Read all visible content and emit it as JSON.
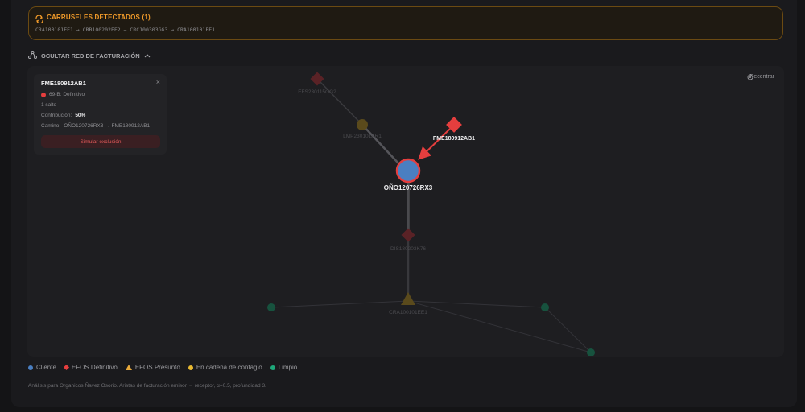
{
  "carousel": {
    "title": "CARRUSELES DETECTADOS (1)",
    "chain": "CRA100101EE1  →  CRB100202FF2  →  CRC100303GG3  →  CRA100101EE1"
  },
  "toggle": {
    "label": "OCULTAR RED DE FACTURACIÓN"
  },
  "graph": {
    "recenter_label": "Recentrar",
    "labels": {
      "n1": "EFS230115GG2",
      "n2": "LMP230101AR1",
      "selected": "FME180912AB1",
      "center": "OÑO120726RX3",
      "n5": "DIS180203K76",
      "n6": "CRA100101EE1"
    },
    "colors": {
      "cliente": "#4a7fc1",
      "efos_definitivo": "#e53e3e",
      "efos_presunto": "#e8a93a",
      "contagio": "#e8b931",
      "limpio": "#1ea87a"
    }
  },
  "info": {
    "title": "FME180912AB1",
    "close": "×",
    "status": "69-B: Definitivo",
    "hops": "1 salto",
    "contribution_label": "Contribución:",
    "contribution_value": "50%",
    "path_label": "Camino:",
    "path": "OÑO120726RX3 → FME180912AB1",
    "button": "Simular exclusión"
  },
  "legend": [
    {
      "label": "Cliente"
    },
    {
      "label": "EFOS Definitivo"
    },
    {
      "label": "EFOS Presunto"
    },
    {
      "label": "En cadena de contagio"
    },
    {
      "label": "Limpio"
    }
  ],
  "footer": "Análisis para Organicos Ñavez Osorio. Aristas de facturación emisor → receptor, α=0.5, profundidad 3."
}
